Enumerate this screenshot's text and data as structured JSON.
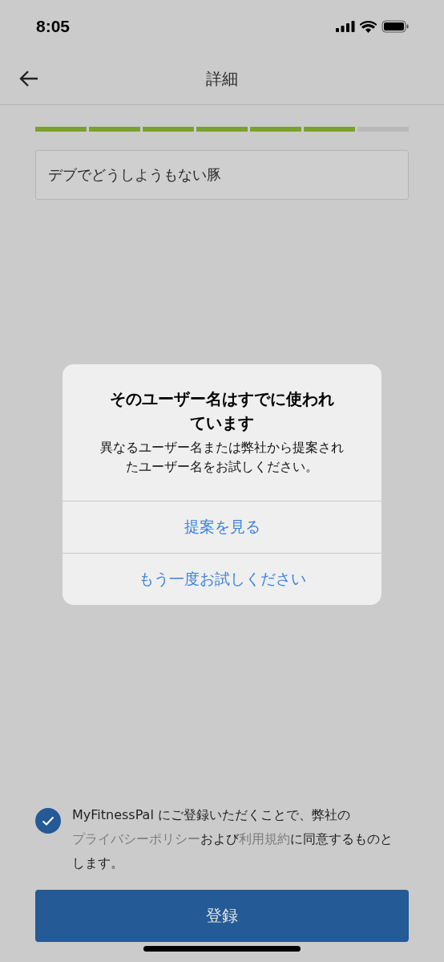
{
  "status_bar": {
    "time": "8:05"
  },
  "nav": {
    "title": "詳細"
  },
  "progress": {
    "steps": [
      {
        "done": true
      },
      {
        "done": true
      },
      {
        "done": true
      },
      {
        "done": true
      },
      {
        "done": true
      },
      {
        "done": true
      },
      {
        "done": false
      }
    ]
  },
  "username_field": {
    "value": "デブでどうしようもない豚"
  },
  "alert": {
    "title": "そのユーザー名はすでに使われています",
    "message": "異なるユーザー名または弊社から提案されたユーザー名をお試しください。",
    "actions": [
      "提案を見る",
      "もう一度お試しください"
    ]
  },
  "agreement": {
    "checked": true,
    "parts": [
      {
        "kind": "text",
        "text": "MyFitnessPal にご登録いただくことで、弊社の"
      },
      {
        "kind": "link",
        "text": "プライバシーポリシー"
      },
      {
        "kind": "text",
        "text": "および"
      },
      {
        "kind": "link",
        "text": "利用規約"
      },
      {
        "kind": "text",
        "text": "に同意するものとします。"
      }
    ]
  },
  "register_button": {
    "label": "登録"
  }
}
